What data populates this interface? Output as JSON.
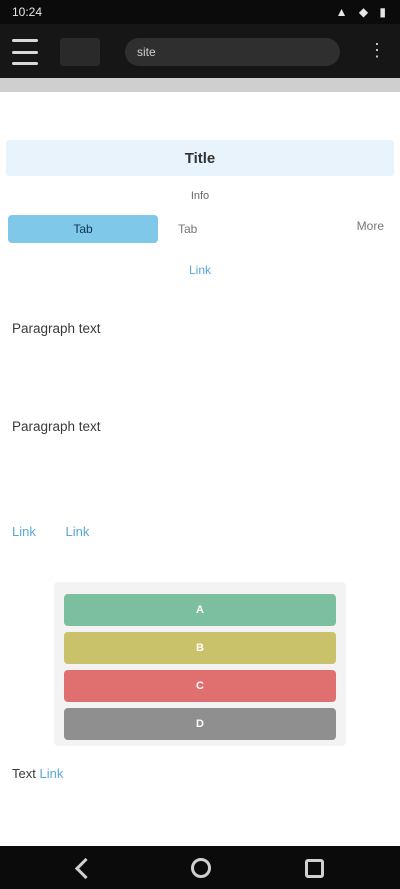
{
  "status_bar": {
    "time": "10:24",
    "icons": "▲ ◆ ▮"
  },
  "header": {
    "url": "site",
    "menu_icon": "⋮"
  },
  "banner": {
    "title": "Title"
  },
  "info": {
    "line": "Info"
  },
  "tabs": {
    "primary": "Tab",
    "secondary": "Tab",
    "more": "More"
  },
  "link_line": "Link",
  "paragraphs": [
    "Paragraph text",
    "Paragraph text"
  ],
  "links": [
    "Link",
    "Link"
  ],
  "chart": {
    "bands": [
      {
        "label": "A",
        "color": "#7bbf9e"
      },
      {
        "label": "B",
        "color": "#c9c26a"
      },
      {
        "label": "C",
        "color": "#e06f6f"
      },
      {
        "label": "D",
        "color": "#8f8f8f"
      }
    ]
  },
  "footer": {
    "text_before": "Text",
    "link": "Link"
  },
  "colors": {
    "accent": "#7fc8ea",
    "link": "#5aa7d8",
    "header_bg": "#161616"
  }
}
